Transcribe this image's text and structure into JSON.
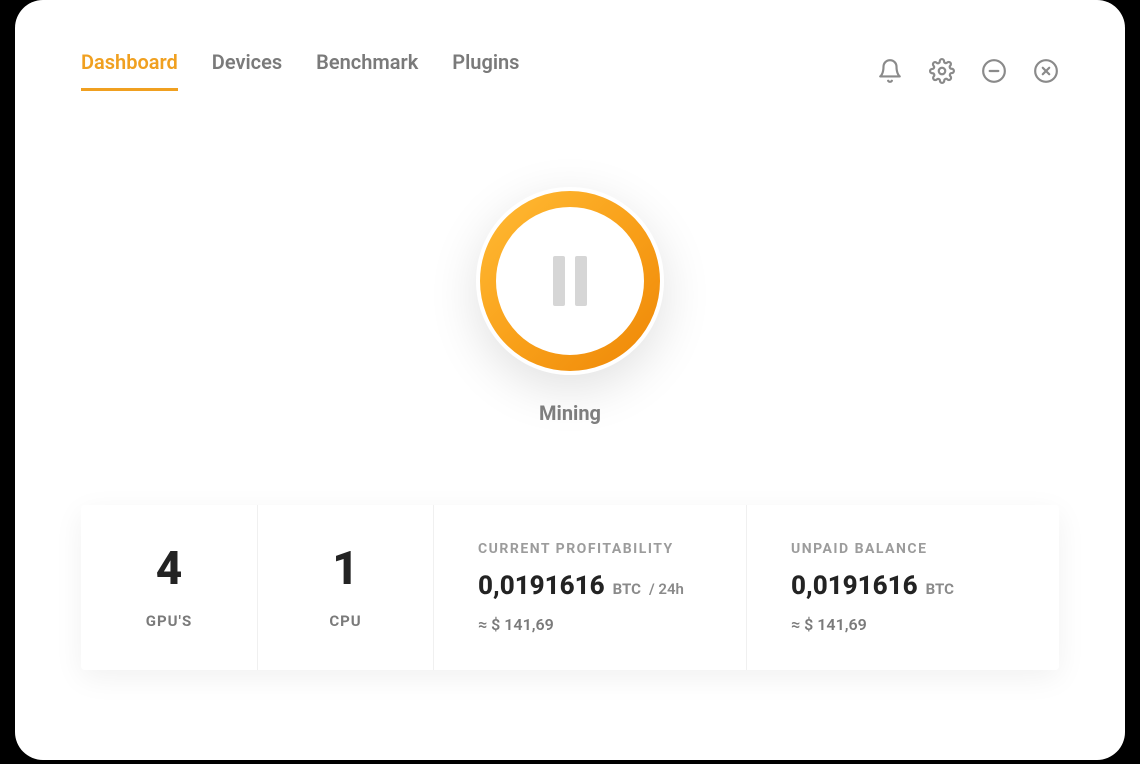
{
  "tabs": {
    "dashboard": "Dashboard",
    "devices": "Devices",
    "benchmark": "Benchmark",
    "plugins": "Plugins"
  },
  "status": {
    "label": "Mining"
  },
  "stats": {
    "gpu": {
      "value": "4",
      "label": "GPU'S"
    },
    "cpu": {
      "value": "1",
      "label": "CPU"
    },
    "profitability": {
      "title": "CURRENT PROFITABILITY",
      "value": "0,0191616",
      "unit": "BTC",
      "per": "/ 24h",
      "approx": "≈ $ 141,69"
    },
    "balance": {
      "title": "UNPAID BALANCE",
      "value": "0,0191616",
      "unit": "BTC",
      "approx": "≈ $ 141,69"
    }
  },
  "colors": {
    "accent": "#f0a020"
  }
}
